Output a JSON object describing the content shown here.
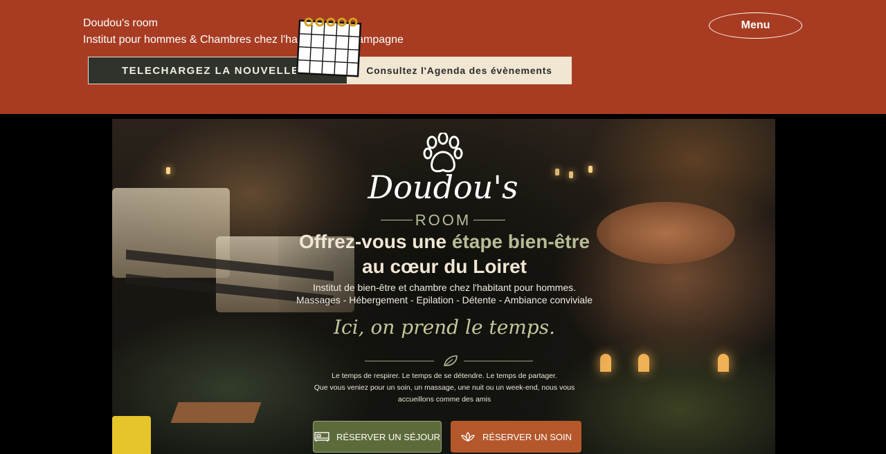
{
  "header": {
    "site_title": "Doudou's room",
    "site_subtitle": "Institut pour hommes & Chambres chez l'habitant en Champagne",
    "menu_label": "Menu",
    "download_button": "TELECHARGEZ LA NOUVELLE BROCHURE",
    "agenda_button": "Consultez l'Agenda des évènements"
  },
  "hero": {
    "logo_name": "Doudou's",
    "logo_room": "ROOM",
    "headline_part1": "Offrez-vous une",
    "headline_highlight": "étape bien-être",
    "headline_line2": "au cœur du Loiret",
    "tagline1": "Institut de bien-être et chambre chez l'habitant pour hommes.",
    "tagline2": "Massages - Hébergement - Epilation - Détente - Ambiance conviviale",
    "script": "Ici, on prend le temps.",
    "body1": "Le temps de respirer. Le temps de se détendre. Le temps de partager.",
    "body2": "Que vous veniez pour un soin, un massage, une nuit ou un week-end, nous vous",
    "body3": "accueillons comme  des amis",
    "btn_sejour": "RÉSERVER UN SÉJOUR",
    "btn_soin": "RÉSERVER UN SOIN"
  },
  "colors": {
    "header_bg": "#a83c22",
    "accent_olive": "#5d6a3a",
    "accent_copper": "#b4582c",
    "agenda_bg": "#f0e6d2"
  },
  "icons": [
    "calendar-icon",
    "paw-icon",
    "leaf-icon",
    "bed-icon",
    "lotus-icon"
  ]
}
